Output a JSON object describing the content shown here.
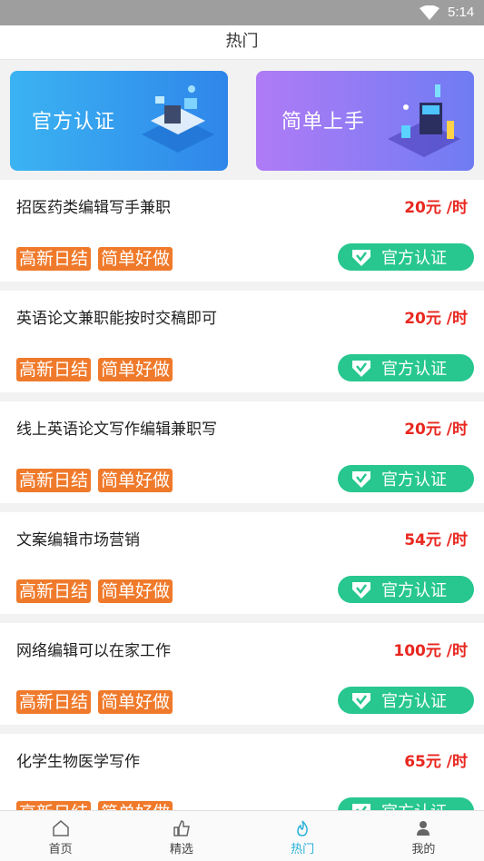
{
  "status_bar": {
    "time": "5:14"
  },
  "page_title": "热门",
  "banners": [
    {
      "label": "官方认证"
    },
    {
      "label": "简单上手"
    }
  ],
  "jobs": [
    {
      "title": "招医药类编辑写手兼职",
      "salary": "20元 /时",
      "tags": [
        "高新日结",
        "简单好做"
      ],
      "cert": "官方认证"
    },
    {
      "title": "英语论文兼职能按时交稿即可",
      "salary": "20元 /时",
      "tags": [
        "高新日结",
        "简单好做"
      ],
      "cert": "官方认证"
    },
    {
      "title": "线上英语论文写作编辑兼职写",
      "salary": "20元 /时",
      "tags": [
        "高新日结",
        "简单好做"
      ],
      "cert": "官方认证"
    },
    {
      "title": "文案编辑市场营销",
      "salary": "54元 /时",
      "tags": [
        "高新日结",
        "简单好做"
      ],
      "cert": "官方认证"
    },
    {
      "title": "网络编辑可以在家工作",
      "salary": "100元 /时",
      "tags": [
        "高新日结",
        "简单好做"
      ],
      "cert": "官方认证"
    },
    {
      "title": "化学生物医学写作",
      "salary": "65元 /时",
      "tags": [
        "高新日结",
        "简单好做"
      ],
      "cert": "官方认证"
    }
  ],
  "tabs": [
    {
      "label": "首页",
      "icon": "home-icon",
      "active": false
    },
    {
      "label": "精选",
      "icon": "thumbs-up-icon",
      "active": false
    },
    {
      "label": "热门",
      "icon": "hot-icon",
      "active": true
    },
    {
      "label": "我的",
      "icon": "person-icon",
      "active": false
    }
  ],
  "colors": {
    "salary": "#e8271f",
    "tag": "#f07a2b",
    "cert": "#27c78f",
    "tab_active": "#27b0d8"
  }
}
